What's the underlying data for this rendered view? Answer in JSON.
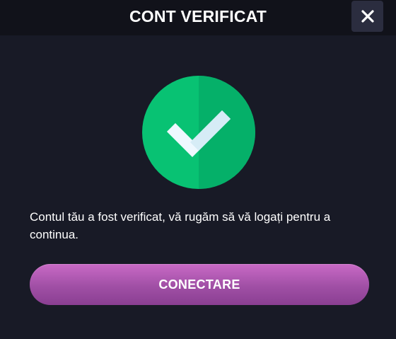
{
  "dialog": {
    "title": "CONT VERIFICAT",
    "close_icon": "close-icon"
  },
  "content": {
    "status_icon": "checkmark-circle-icon",
    "message": "Contul tău a fost verificat, vă rugăm să vă logați pentru a continua.",
    "button_label": "CONECTARE"
  },
  "colors": {
    "background": "#181a26",
    "header": "#11121a",
    "success_green": "#08bd6f",
    "button_accent": "#b85bb6",
    "close_button_bg": "#2b2d3f"
  }
}
